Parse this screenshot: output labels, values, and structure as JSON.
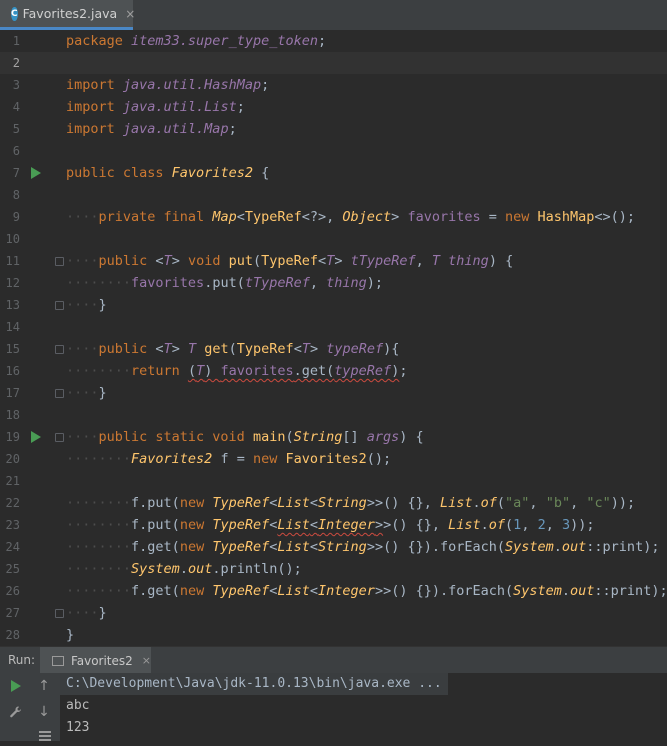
{
  "editor_tab": {
    "label": "Favorites2.java",
    "icon": "java-class-icon",
    "close": "×",
    "icon_letter": "C"
  },
  "code_lines": [
    {
      "n": "1",
      "html": "<span class=\"kw\">package </span><span class=\"pkg\">item33.super_type_token</span><span class=\"punct\">;</span>"
    },
    {
      "n": "2",
      "html": ""
    },
    {
      "n": "3",
      "html": "<span class=\"kw\">import </span><span class=\"pkg\">java.util.HashMap</span><span class=\"punct\">;</span>"
    },
    {
      "n": "4",
      "html": "<span class=\"kw\">import </span><span class=\"pkg\">java.util.List</span><span class=\"punct\">;</span>"
    },
    {
      "n": "5",
      "html": "<span class=\"kw\">import </span><span class=\"pkg\">java.util.Map</span><span class=\"punct\">;</span>"
    },
    {
      "n": "6",
      "html": ""
    },
    {
      "n": "7",
      "html": "<span class=\"kw\">public class </span><span class=\"cls\">Favorites2</span> <span class=\"punct\">{</span>"
    },
    {
      "n": "8",
      "html": ""
    },
    {
      "n": "9",
      "html": "<span class=\"indent\">····</span><span class=\"kw\">private final </span><span class=\"cls\">Map</span><span class=\"punct\">&lt;</span><span class=\"ty\">TypeRef</span><span class=\"punct\">&lt;?&gt;, </span><span class=\"cls\">Object</span><span class=\"punct\">&gt; </span><span class=\"fld\">favorites</span><span class=\"punct\"> = </span><span class=\"kw\">new </span><span class=\"ty\">HashMap</span><span class=\"punct\">&lt;&gt;();</span>"
    },
    {
      "n": "10",
      "html": ""
    },
    {
      "n": "11",
      "html": "<span class=\"indent\">····</span><span class=\"kw\">public </span><span class=\"punct\">&lt;</span><span class=\"tp\">T</span><span class=\"punct\">&gt; </span><span class=\"kw\">void </span><span class=\"ty\">put</span><span class=\"punct\">(</span><span class=\"ty\">TypeRef</span><span class=\"punct\">&lt;</span><span class=\"tp\">T</span><span class=\"punct\">&gt; </span><span class=\"par\">tTypeRef</span><span class=\"punct\">, </span><span class=\"tp\">T</span> <span class=\"par\">thing</span><span class=\"punct\">) {</span>"
    },
    {
      "n": "12",
      "html": "<span class=\"indent\">········</span><span class=\"fld\">favorites</span><span class=\"punct\">.put(</span><span class=\"par\">tTypeRef</span><span class=\"punct\">, </span><span class=\"par\">thing</span><span class=\"punct\">);</span>"
    },
    {
      "n": "13",
      "html": "<span class=\"indent\">····</span><span class=\"punct\">}</span>"
    },
    {
      "n": "14",
      "html": ""
    },
    {
      "n": "15",
      "html": "<span class=\"indent\">····</span><span class=\"kw\">public </span><span class=\"punct\">&lt;</span><span class=\"tp\">T</span><span class=\"punct\">&gt; </span><span class=\"tp\">T</span> <span class=\"ty\">get</span><span class=\"punct\">(</span><span class=\"ty\">TypeRef</span><span class=\"punct\">&lt;</span><span class=\"tp\">T</span><span class=\"punct\">&gt; </span><span class=\"par\">typeRef</span><span class=\"punct\">){</span>"
    },
    {
      "n": "16",
      "html": "<span class=\"indent\">········</span><span class=\"kw\">return </span><span class=\"warn\"><span class=\"punct\">(</span><span class=\"tp\">T</span><span class=\"punct\">) </span><span class=\"fld\">favorites</span><span class=\"punct\">.get(</span><span class=\"par\">typeRef</span><span class=\"punct\">)</span></span><span class=\"punct\">;</span>"
    },
    {
      "n": "17",
      "html": "<span class=\"indent\">····</span><span class=\"punct\">}</span>"
    },
    {
      "n": "18",
      "html": ""
    },
    {
      "n": "19",
      "html": "<span class=\"indent\">····</span><span class=\"kw\">public static void </span><span class=\"ty\">main</span><span class=\"punct\">(</span><span class=\"cls\">String</span><span class=\"punct\">[] </span><span class=\"par\">args</span><span class=\"punct\">) {</span>"
    },
    {
      "n": "20",
      "html": "<span class=\"indent\">········</span><span class=\"cls\">Favorites2</span> <span class=\"fn\">f</span><span class=\"punct\"> = </span><span class=\"kw\">new </span><span class=\"ty\">Favorites2</span><span class=\"punct\">();</span>"
    },
    {
      "n": "21",
      "html": ""
    },
    {
      "n": "22",
      "html": "<span class=\"indent\">········</span><span class=\"fn\">f</span><span class=\"punct\">.put(</span><span class=\"kw\">new </span><span class=\"cls\">TypeRef</span><span class=\"punct\">&lt;</span><span class=\"cls\">List</span><span class=\"punct\">&lt;</span><span class=\"cls\">String</span><span class=\"punct\">&gt;&gt;() {}, </span><span class=\"cls\">List</span><span class=\"punct\">.</span><span class=\"static\">of</span><span class=\"punct\">(</span><span class=\"str\">\"a\"</span><span class=\"punct\">, </span><span class=\"str\">\"b\"</span><span class=\"punct\">, </span><span class=\"str\">\"c\"</span><span class=\"punct\">));</span>"
    },
    {
      "n": "23",
      "html": "<span class=\"indent\">········</span><span class=\"fn\">f</span><span class=\"punct\">.put(</span><span class=\"kw\">new </span><span class=\"cls\">TypeRef</span><span class=\"punct\">&lt;</span><span class=\"warn\"><span class=\"cls\">List</span><span class=\"punct\">&lt;</span><span class=\"cls\">Integer</span><span class=\"punct\">&gt;</span></span><span class=\"punct\">&gt;() {}, </span><span class=\"cls\">List</span><span class=\"punct\">.</span><span class=\"static\">of</span><span class=\"punct\">(</span><span class=\"num\">1</span><span class=\"punct\">, </span><span class=\"num\">2</span><span class=\"punct\">, </span><span class=\"num\">3</span><span class=\"punct\">));</span>"
    },
    {
      "n": "24",
      "html": "<span class=\"indent\">········</span><span class=\"fn\">f</span><span class=\"punct\">.get(</span><span class=\"kw\">new </span><span class=\"cls\">TypeRef</span><span class=\"punct\">&lt;</span><span class=\"cls\">List</span><span class=\"punct\">&lt;</span><span class=\"cls\">String</span><span class=\"punct\">&gt;&gt;() {}).forEach(</span><span class=\"cls\">System</span><span class=\"punct\">.</span><span class=\"static\">out</span><span class=\"punct\">::print);</span>"
    },
    {
      "n": "25",
      "html": "<span class=\"indent\">········</span><span class=\"cls\">System</span><span class=\"punct\">.</span><span class=\"static\">out</span><span class=\"punct\">.println();</span>"
    },
    {
      "n": "26",
      "html": "<span class=\"indent\">········</span><span class=\"fn\">f</span><span class=\"punct\">.get(</span><span class=\"kw\">new </span><span class=\"cls\">TypeRef</span><span class=\"punct\">&lt;</span><span class=\"cls\">List</span><span class=\"punct\">&lt;</span><span class=\"cls\">Integer</span><span class=\"punct\">&gt;&gt;() {}).forEach(</span><span class=\"cls\">System</span><span class=\"punct\">.</span><span class=\"static\">out</span><span class=\"punct\">::print);</span>"
    },
    {
      "n": "27",
      "html": "<span class=\"indent\">····</span><span class=\"punct\">}</span>"
    },
    {
      "n": "28",
      "html": "<span class=\"punct\">}</span>"
    }
  ],
  "current_line": "2",
  "run_gutter_lines": [
    "7",
    "19"
  ],
  "fold_lines": [
    "11",
    "13",
    "15",
    "17",
    "19",
    "27"
  ],
  "run_panel": {
    "label": "Run:",
    "tab_label": "Favorites2",
    "tab_close": "×",
    "command": "C:\\Development\\Java\\jdk-11.0.13\\bin\\java.exe ...",
    "output": [
      "abc",
      "123"
    ],
    "buttons": [
      "rerun-icon",
      "scroll-up-icon",
      "settings-wrench-icon",
      "scroll-down-icon",
      "menu-lines-icon"
    ]
  },
  "colors": {
    "keyword": "#cc7832",
    "type": "#ffc66d",
    "string": "#6a8759",
    "number": "#6897bb",
    "field": "#9876aa",
    "background": "#2b2b2b",
    "run_green": "#499c54"
  }
}
